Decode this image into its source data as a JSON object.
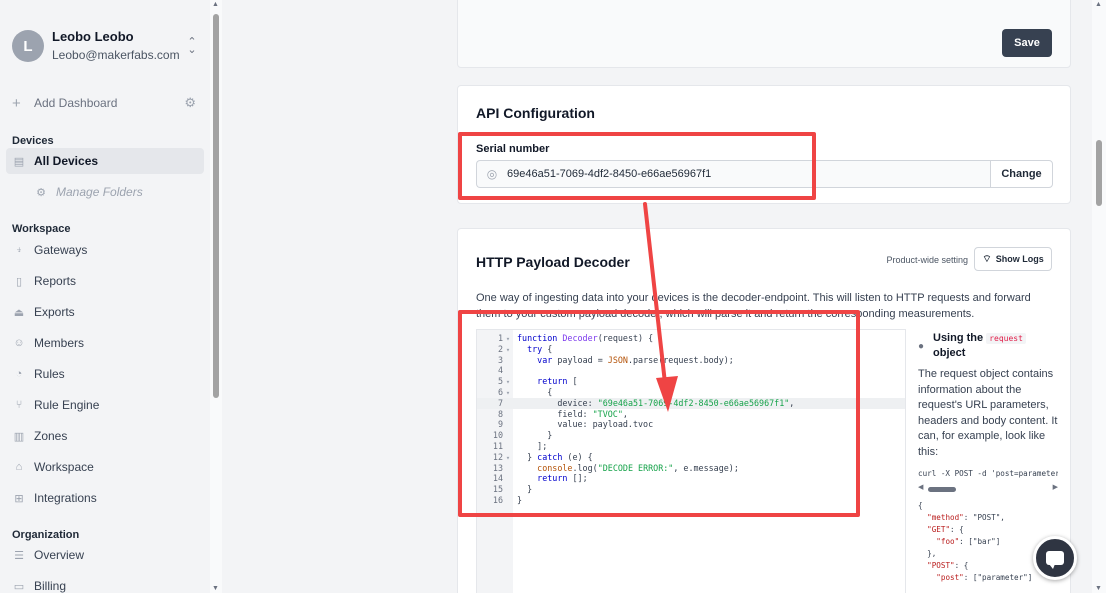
{
  "user": {
    "initial": "L",
    "name": "Leobo Leobo",
    "email": "Leobo@makerfabs.com"
  },
  "sidebar": {
    "add_dashboard": "Add Dashboard",
    "devices_title": "Devices",
    "devices_items": [
      {
        "label": "All Devices",
        "icon": "devices-icon"
      },
      {
        "label": "Manage Folders",
        "icon": "gear-icon"
      }
    ],
    "workspace_title": "Workspace",
    "workspace_items": [
      {
        "label": "Gateways",
        "icon": "antenna-icon"
      },
      {
        "label": "Reports",
        "icon": "file-icon"
      },
      {
        "label": "Exports",
        "icon": "upload-icon"
      },
      {
        "label": "Members",
        "icon": "users-icon"
      },
      {
        "label": "Rules",
        "icon": "rules-icon"
      },
      {
        "label": "Rule Engine",
        "icon": "branch-icon"
      },
      {
        "label": "Zones",
        "icon": "map-icon"
      },
      {
        "label": "Workspace",
        "icon": "home-icon"
      },
      {
        "label": "Integrations",
        "icon": "plus-square-icon"
      }
    ],
    "organization_title": "Organization",
    "organization_items": [
      {
        "label": "Overview",
        "icon": "list-icon"
      },
      {
        "label": "Billing",
        "icon": "card-icon"
      }
    ]
  },
  "top_card": {
    "save_label": "Save"
  },
  "api_config": {
    "title": "API Configuration",
    "serial_label": "Serial number",
    "serial_value": "69e46a51-7069-4df2-8450-e66ae56967f1",
    "change_label": "Change"
  },
  "decoder": {
    "title": "HTTP Payload Decoder",
    "product_wide_label": "Product-wide setting",
    "show_logs_label": "Show Logs",
    "description": "One way of ingesting data into your devices is the decoder-endpoint. This will listen to HTTP requests and forward them to your custom payload decoder, which will parse it and return the corresponding measurements.",
    "code_lines": [
      {
        "n": "1",
        "fold": "▾",
        "text": "function Decoder(request) {"
      },
      {
        "n": "2",
        "fold": "▾",
        "text": "  try {"
      },
      {
        "n": "3",
        "fold": "",
        "text": "    var payload = JSON.parse(request.body);"
      },
      {
        "n": "4",
        "fold": "",
        "text": ""
      },
      {
        "n": "5",
        "fold": "▾",
        "text": "    return ["
      },
      {
        "n": "6",
        "fold": "▾",
        "text": "      {"
      },
      {
        "n": "7",
        "fold": "",
        "text": "        device: \"69e46a51-7069-4df2-8450-e66ae56967f1\","
      },
      {
        "n": "8",
        "fold": "",
        "text": "        field: \"TVOC\","
      },
      {
        "n": "9",
        "fold": "",
        "text": "        value: payload.tvoc"
      },
      {
        "n": "10",
        "fold": "",
        "text": "      }"
      },
      {
        "n": "11",
        "fold": "",
        "text": "    ];"
      },
      {
        "n": "12",
        "fold": "▾",
        "text": "  } catch (e) {"
      },
      {
        "n": "13",
        "fold": "",
        "text": "    console.log(\"DECODE ERROR:\", e.message);"
      },
      {
        "n": "14",
        "fold": "",
        "text": "    return [];"
      },
      {
        "n": "15",
        "fold": "",
        "text": "  }"
      },
      {
        "n": "16",
        "fold": "",
        "text": "}"
      }
    ],
    "doc": {
      "heading_prefix": "Using the",
      "heading_code": "request",
      "heading_suffix": "object",
      "body": "The request object contains information about the request's URL parameters, headers and body content. It can, for example, look like this:",
      "curl": "curl -X POST -d 'post=parameter'",
      "json_lines": [
        "{",
        "  \"method\": \"POST\",",
        "  \"GET\": {",
        "    \"foo\": [\"bar\"]",
        "  },",
        "  \"POST\": {",
        "    \"post\": [\"parameter\"]"
      ]
    }
  },
  "colors": {
    "highlight": "#ef4444",
    "button_dark": "#374151",
    "accent": "#0000cc"
  }
}
